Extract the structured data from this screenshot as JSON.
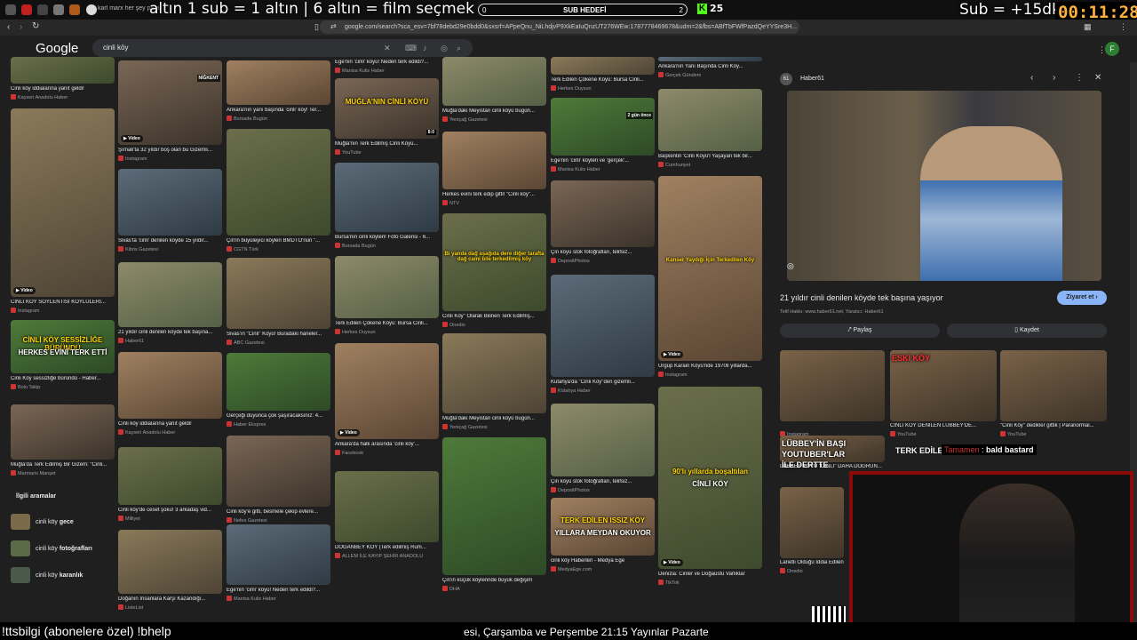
{
  "browser": {
    "tab_title": "karl marx her şey para",
    "url": "google.com/search?sca_esv=7bf78debd29e0bdd0&sxsrf=APpeQnu_NiLhdjvP9XkEaIuQnzUT276WEw:1787778469678&udm=2&fbs=ABfTbFWfPazdQeYYSre3H..."
  },
  "stream_overlay": {
    "rule_text": "altın   1 sub = 1 altın | 6 altın = film seçmek",
    "goal_label": "SUB HEDEFİ",
    "goal_current": "0",
    "goal_target": "2",
    "kick_label": "K",
    "viewer_count": "25",
    "sub_time": "Sub = +15dk",
    "timer": "00:11:28"
  },
  "google": {
    "logo": "Google",
    "query": "cinli köy"
  },
  "grid": {
    "col1": [
      {
        "cap": "Cinli köy iddialarına yanıt geldi!",
        "src": "Kayseri Anadolu Haber"
      },
      {
        "cap": "CİNLİ KÖY SÖYLENTİSİ KÖYLÜLERİ...",
        "src": "Instagram",
        "badge": "Video"
      },
      {
        "cap": "Cinli Köy sessizliğe büründü - Haber...",
        "src": "Bolu Takip",
        "ov1": "CİNLİ KÖY SESSİZLİĞE BÜRÜNDÜ",
        "ov2": "HERKES EVİNİ TERK ETTİ"
      },
      {
        "cap": "Muğla'da Terk Edilmiş Bir Gizem: \"Cinli...",
        "src": "Marmaris Manşet"
      }
    ],
    "col2": [
      {
        "cap": "Şırnak'ta 32 yıldır boş olan bu Gizemli...",
        "src": "Instagram",
        "badge": "Video",
        "tag": "NİĞKENT"
      },
      {
        "cap": "Sivas'ta 'cinli' denilen köyde 15 yıldır...",
        "src": "Kibris Gazetesi"
      },
      {
        "cap": "21 yıldır cinli denilen köyde tek başına...",
        "src": "Haber61"
      },
      {
        "cap": "Cinli köy iddialarına yanıt geldi!",
        "src": "Kayseri Anadolu Haber"
      },
      {
        "cap": "Cinli köy'de ceset şoku! 3 arkadaş vid...",
        "src": "Milliyet"
      },
      {
        "cap": "Doğanın İnsanlara Karşı Kazandığı...",
        "src": "ListeList"
      }
    ],
    "col3": [
      {
        "cap": "Ankara'nın yanı başında 'cinli' köy! Ter...",
        "src": "Bursada Bugün"
      },
      {
        "cap": "Çin'in büyüleyici köyleri BMDTÖ'nün \"...",
        "src": "CGTN Türk"
      },
      {
        "cap": "Sivas'ın \"Cinli\" Köyü! Buradaki haneler...",
        "src": "ABC Gazetesi"
      },
      {
        "cap": "Gerçeği duyunca çok şaşıracaksınız: 4...",
        "src": "Haber Ekspres"
      },
      {
        "cap": "Cinli köy'e gitti, besmele çekip evlere...",
        "src": "Nefes Gazetesi"
      },
      {
        "cap": "Ege'nin 'cinli' köyü! Neden terk edildi?...",
        "src": "Manisa Kulis Haber"
      }
    ],
    "col4": [
      {
        "cap": "Ege'nin 'cinli' köyü! Neden terk edildi?...",
        "src": "Manisa Kulis Haber"
      },
      {
        "cap": "Muğla'nın Terk Edilmiş Cinli Köyü...",
        "src": "YouTube",
        "ov1": "MUĞLA'NIN CİNLİ KÖYÜ",
        "dur": "8:0"
      },
      {
        "cap": "Bursa'nın cinli köyleri! Foto Galerisi - 6...",
        "src": "Bursada Bugün"
      },
      {
        "cap": "Terk Edilen Çökene Köyü: Bursa Cinli...",
        "src": "Herkes Duysun"
      },
      {
        "cap": "Ankara'da halk arasında 'cinli köy'...",
        "src": "Facebook",
        "badge": "Video"
      },
      {
        "cap": "DOĞANBEY KÖY (Terk edilmiş Rum...",
        "src": "ALLEM İLE KAYIP ŞEHİR ANADOLU"
      }
    ],
    "col5": [
      {
        "cap": "Muğla'daki Meyistan cinli köyü bugün...",
        "src": "Yeniçağ Gazetesi"
      },
      {
        "cap": "Herkes evini terk edip gitti! \"Cinli köy\"...",
        "src": "NTV"
      },
      {
        "cap": "Cinli Köy\" Olarak Bilinen Terk Edilmiş...",
        "src": "Onedio",
        "ov1": "Bi yanda dağ aşağıda dere diğer tarafta dağ cami bile terkedilmiş köy"
      },
      {
        "cap": "Muğla'daki Meyistan cinli köyü bugün...",
        "src": "Yeniçağ Gazetesi"
      },
      {
        "cap": "Çin'in küçük köylerinde büyük değişim",
        "src": "DHA"
      }
    ],
    "col6": [
      {
        "cap": "Terk Edilen Çökene Köyü: Bursa Cinli...",
        "src": "Herkes Duysun"
      },
      {
        "cap": "Ege'nin 'cinli' köyleri ve 'gerçek'...",
        "src": "Manisa Kulis Haber",
        "tag": "2 gün önce"
      },
      {
        "cap": "Çin köyü stok fotoğrafları, telifsiz...",
        "src": "DepositPhotos"
      },
      {
        "cap": "Kütahya'da \"Cinli Köy\"den gizemli...",
        "src": "Kütahya Haber"
      },
      {
        "cap": "Çin köyü stok fotoğrafları, telifsiz...",
        "src": "DepositPhotos"
      },
      {
        "cap": "cinli köy Haberleri - Medya Ege",
        "src": "MedyaEge.com",
        "ov1": "TERK EDİLEN ISSIZ KÖY",
        "ov2": "YILLARA MEYDAN OKUYOR"
      }
    ],
    "col7": [
      {
        "cap": "Ankara'nın Yanı Başında Cinli Köy...",
        "src": "Gerçek Gündem"
      },
      {
        "cap": "Başkentin 'Cinli Köyü'l Yaşayan tek bir...",
        "src": "Cumhuriyet"
      },
      {
        "cap": "Ürgüp Karain Köyü'nde 1970li yıllarda...",
        "src": "Instagram",
        "badge": "Video",
        "ov1": "Kanser Yaydığı İçin Terkedilen Köy"
      },
      {
        "cap": "Denizia: Cinler ve Doğaüstü Varlıklar",
        "src": "TikTok",
        "badge": "Video",
        "ov1": "90'lı yıllarda boşaltılan",
        "ov2": "CİNLİ KÖY"
      }
    ]
  },
  "related": {
    "title": "İlgili aramalar",
    "items": [
      {
        "prefix": "cinli köy ",
        "bold": "gece"
      },
      {
        "prefix": "cinli köy ",
        "bold": "fotoğrafları"
      },
      {
        "prefix": "cinli köy ",
        "bold": "karanlık"
      }
    ]
  },
  "panel": {
    "source": "Haber61",
    "title": "21 yıldır cinli denilen köyde tek başına yaşıyor",
    "visit_label": "Ziyaret et",
    "meta": "Telif Hakkı: www.haber61.net, Yaratıcı: Haber61",
    "share_label": "Paylaş",
    "save_label": "Kaydet",
    "related": [
      {
        "cap": "",
        "src": "Instagram"
      },
      {
        "cap": "CİNLİ KÖY DENİLEN LÜBBEY'DE...",
        "src": "YouTube",
        "ov1": "ESKİ KÖY"
      },
      {
        "cap": "\"Cinli Köy\" dedikler gittik | Paranormal...",
        "src": "YouTube"
      },
      {
        "cap": "LÜBBEY KÖYÜ \"CİNLİ\" DAHA DOĞRUN...",
        "src": "",
        "ov1": "LÜBBEY'İN BAŞI",
        "ov2": "YOUTUBER'LAR",
        "ov3": "İLE DERTTE"
      },
      {
        "cap": "Lanetli Olduğu İddia Edilen...",
        "src": "Onedio"
      }
    ],
    "row3_ov": "TERK EDİLEN",
    "chat_user": "Tamamen",
    "chat_msg": "bald bastard"
  },
  "ticker": {
    "left": "!ttsbilgi (abonelere özel)    !bhelp",
    "right": "esi, Çarşamba ve Perşembe 21:15        Yayınlar Pazarte"
  },
  "colors": {
    "accent": "#8ab4f8",
    "overlay_timer": "#ffb13d",
    "kick_green": "#53fc18",
    "cam_border": "#8b0a0a"
  }
}
